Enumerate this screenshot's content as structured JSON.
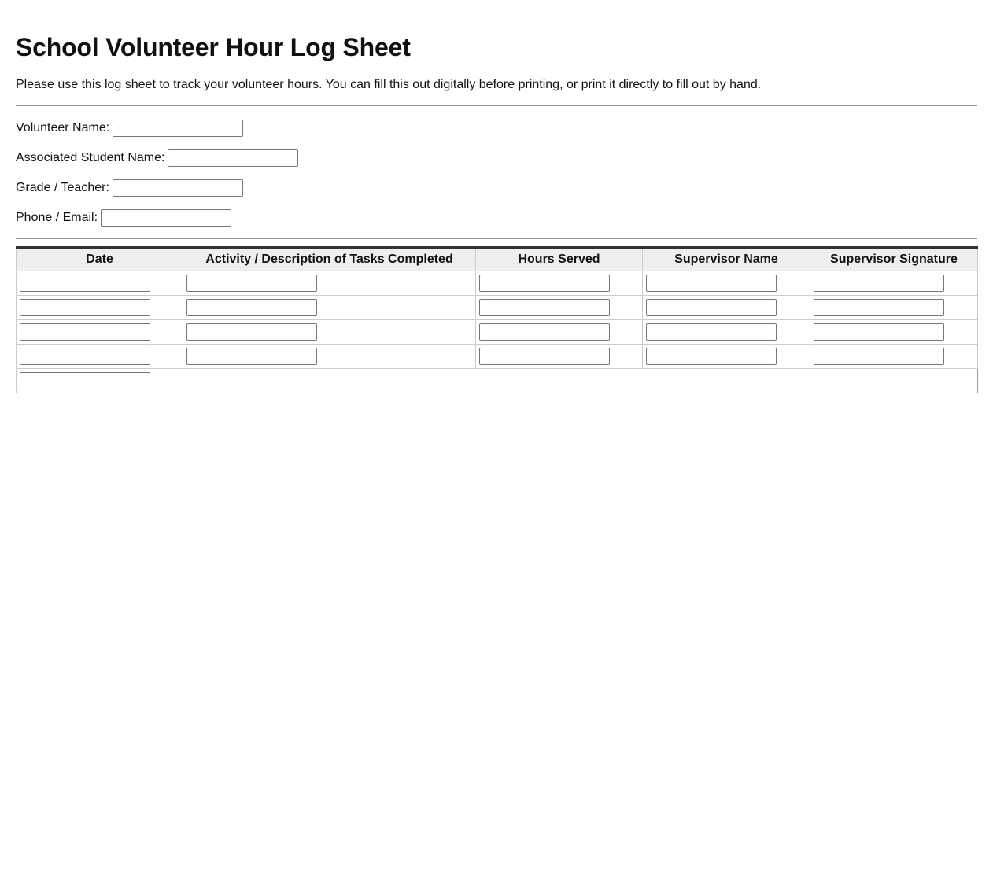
{
  "page": {
    "title": "School Volunteer Hour Log Sheet",
    "intro": "Please use this log sheet to track your volunteer hours. You can fill this out digitally before printing, or print it directly to fill out by hand."
  },
  "info_fields": [
    {
      "label": "Volunteer Name:",
      "value": ""
    },
    {
      "label": "Associated Student Name:",
      "value": ""
    },
    {
      "label": "Grade / Teacher:",
      "value": ""
    },
    {
      "label": "Phone / Email:",
      "value": ""
    }
  ],
  "log_table": {
    "columns": [
      "Date",
      "Activity / Description of Tasks Completed",
      "Hours Served",
      "Supervisor Name",
      "Supervisor Signature"
    ],
    "rows": [
      {
        "date": "",
        "activity": "",
        "hours": "",
        "supervisor_name": "",
        "supervisor_signature": ""
      },
      {
        "date": "",
        "activity": "",
        "hours": "",
        "supervisor_name": "",
        "supervisor_signature": ""
      },
      {
        "date": "",
        "activity": "",
        "hours": "",
        "supervisor_name": "",
        "supervisor_signature": ""
      },
      {
        "date": "",
        "activity": "",
        "hours": "",
        "supervisor_name": "",
        "supervisor_signature": ""
      }
    ],
    "partial_row": {
      "date": ""
    }
  }
}
